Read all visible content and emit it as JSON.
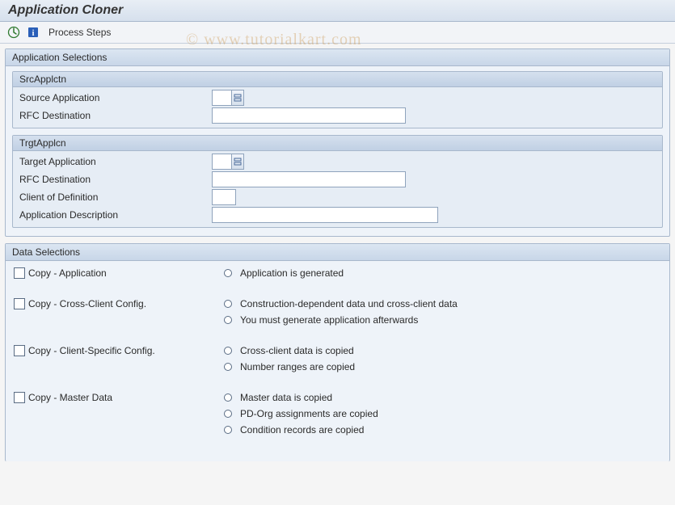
{
  "title": "Application Cloner",
  "toolbar": {
    "process_steps": "Process Steps"
  },
  "watermark": "© www.tutorialkart.com",
  "app_selections": {
    "title": "Application Selections",
    "src": {
      "title": "SrcApplctn",
      "source_application_label": "Source Application",
      "source_application_value": "",
      "rfc_label": "RFC Destination",
      "rfc_value": ""
    },
    "trgt": {
      "title": "TrgtApplcn",
      "target_application_label": "Target Application",
      "target_application_value": "",
      "rfc_label": "RFC Destination",
      "rfc_value": "",
      "client_label": "Client of Definition",
      "client_value": "",
      "desc_label": "Application Description",
      "desc_value": ""
    }
  },
  "data_selections": {
    "title": "Data Selections",
    "items": [
      {
        "label": "Copy - Application",
        "checked": false,
        "bullets": [
          "Application is generated"
        ]
      },
      {
        "label": "Copy - Cross-Client Config.",
        "checked": false,
        "bullets": [
          "Construction-dependent data und cross-client data",
          "You must generate application afterwards"
        ]
      },
      {
        "label": "Copy - Client-Specific Config.",
        "checked": false,
        "bullets": [
          "Cross-client data is copied",
          "Number ranges are copied"
        ]
      },
      {
        "label": "Copy - Master Data",
        "checked": false,
        "bullets": [
          "Master data is copied",
          "PD-Org assignments are copied",
          "Condition records are copied"
        ]
      }
    ]
  }
}
